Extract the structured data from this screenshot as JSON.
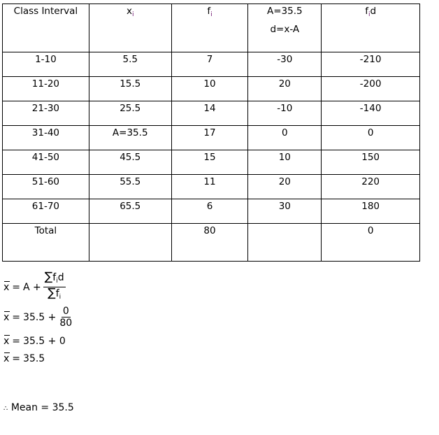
{
  "table": {
    "headers": {
      "class_interval": "Class Interval",
      "xi_base": "x",
      "xi_sub": "i",
      "fi_base": "f",
      "fi_sub": "i",
      "d_line1": "A=35.5",
      "d_line2": "d=x-A",
      "fid_base": "f",
      "fid_sub": "i",
      "fid_tail": "d"
    },
    "rows": [
      {
        "interval": "1-10",
        "x": "5.5",
        "f": "7",
        "d": "-30",
        "fd": "-210"
      },
      {
        "interval": "11-20",
        "x": "15.5",
        "f": "10",
        "d": "20",
        "fd": "-200"
      },
      {
        "interval": "21-30",
        "x": "25.5",
        "f": "14",
        "d": "-10",
        "fd": "-140"
      },
      {
        "interval": "31-40",
        "x": "A=35.5",
        "f": "17",
        "d": "0",
        "fd": "0"
      },
      {
        "interval": "41-50",
        "x": "45.5",
        "f": "15",
        "d": "10",
        "fd": "150"
      },
      {
        "interval": "51-60",
        "x": "55.5",
        "f": "11",
        "d": "20",
        "fd": "220"
      },
      {
        "interval": "61-70",
        "x": "65.5",
        "f": "6",
        "d": "30",
        "fd": "180"
      }
    ],
    "total": {
      "label": "Total",
      "x": "",
      "f": "80",
      "d": "",
      "fd": "0"
    }
  },
  "formulas": {
    "xbar": "x",
    "eq": "=",
    "line1": {
      "lhs_rest": "A +",
      "sigma": "∑",
      "num_f": "f",
      "num_sub": "i",
      "num_tail": "d",
      "den_f": "f",
      "den_sub": "i"
    },
    "line2": {
      "lhs_rest": "35.5 +",
      "num": "0",
      "den": "80"
    },
    "line3": {
      "rhs": "35.5 + 0"
    },
    "line4": {
      "rhs": "35.5"
    }
  },
  "conclusion": {
    "therefore": "∴",
    "text": "Mean = 35.5"
  },
  "colors": {
    "subscript": "#6b0f6b",
    "border": "#000000"
  }
}
